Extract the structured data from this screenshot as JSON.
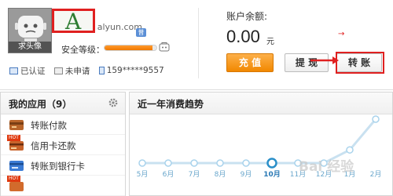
{
  "profile": {
    "avatar_label": "求头像",
    "account_visible": "alyun.com",
    "account_prefix": "a",
    "highlight_letter": "A",
    "vip_badge": "普",
    "security_label": "安全等级：",
    "security_level": 0.92
  },
  "verify": {
    "items": [
      {
        "label": "已认证",
        "icon": "id-card-icon"
      },
      {
        "label": "未申请",
        "icon": "certificate-icon"
      },
      {
        "label": "159*****9557",
        "icon": "phone-icon"
      }
    ]
  },
  "balance": {
    "label": "账户余额:",
    "value": "0.00",
    "unit": "元",
    "marker": "→"
  },
  "buttons": {
    "recharge": "充 值",
    "withdraw": "提 现",
    "transfer": "转 账"
  },
  "apps": {
    "title": "我的应用（9）",
    "items": [
      {
        "label": "转账付款",
        "icon": "transfer-payment-icon",
        "hot": ""
      },
      {
        "label": "信用卡还款",
        "icon": "credit-card-icon",
        "hot": "HOT"
      },
      {
        "label": "转账到银行卡",
        "icon": "bank-card-icon",
        "hot": ""
      },
      {
        "label": "",
        "icon": "app-icon",
        "hot": "HOT"
      }
    ]
  },
  "trend": {
    "title": "近一年消费趋势"
  },
  "chart_data": {
    "type": "line",
    "categories": [
      "5月",
      "6月",
      "7月",
      "8月",
      "9月",
      "10月",
      "11月",
      "12月",
      "1月",
      "2月"
    ],
    "values": [
      0,
      0,
      0,
      0,
      0,
      0,
      0,
      0,
      0.3,
      1
    ],
    "highlight_index": 5,
    "title": "近一年消费趋势",
    "xlabel": "",
    "ylabel": ""
  },
  "watermark": "Bai 经验",
  "colors": {
    "accent_orange": "#f18800",
    "alert_red": "#e02020",
    "chart_line": "#c9e1f0",
    "chart_point": "#5fb6e6"
  }
}
